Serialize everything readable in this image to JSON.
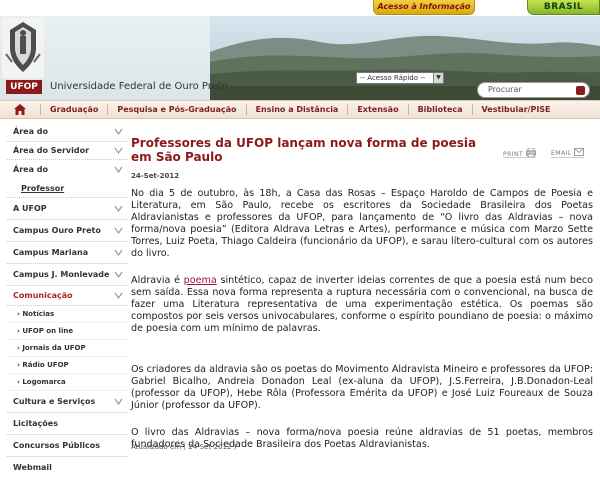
{
  "topbar": {
    "acesso_label": "Acesso à Informação",
    "brasil_label": "BRASIL"
  },
  "header": {
    "badge": "UFOP",
    "university_name": "Universidade Federal de Ouro Preto",
    "quick_access": "-- Acesso Rápido --",
    "search_placeholder": "Procurar"
  },
  "nav": {
    "items": [
      "Graduação",
      "Pesquisa e Pós-Graduação",
      "Ensino a Distância",
      "Extensão",
      "Biblioteca",
      "Vestibular/PISE"
    ]
  },
  "sidebar": {
    "items": [
      {
        "label": "Área do",
        "chevron": true
      },
      {
        "label": "Área do Servidor",
        "chevron": true
      },
      {
        "label": "Área do",
        "chevron": true
      },
      {
        "label": "Professor",
        "chevron": false
      },
      {
        "label": "A UFOP",
        "chevron": true
      },
      {
        "label": "Campus Ouro Preto",
        "chevron": true
      },
      {
        "label": "Campus Mariana",
        "chevron": true
      },
      {
        "label": "Campus J. Monlevade",
        "chevron": true
      },
      {
        "label": "Comunicação",
        "chevron": true
      },
      {
        "label": "Cultura e Serviços",
        "chevron": true
      },
      {
        "label": "Licitações",
        "chevron": false
      },
      {
        "label": "Concursos Públicos",
        "chevron": false
      },
      {
        "label": "Webmail",
        "chevron": false
      }
    ],
    "comunicacao_subitems": [
      "Notícias",
      "UFOP on line",
      "Jornais da UFOP",
      "Rádio UFOP",
      "Logomarca"
    ]
  },
  "article": {
    "title": "Professores da UFOP lançam nova forma de poesia em São Paulo",
    "print_label": "PRINT",
    "email_label": "EMAIL",
    "date": "24-Set-2012",
    "paragraphs": [
      "No dia 5 de outubro, às 18h, a Casa das Rosas – Espaço Haroldo de Campos de Poesia e Literatura, em São Paulo, recebe os escritores da Sociedade Brasileira dos Poetas Aldravianistas e professores da UFOP, para lançamento de “O livro das Aldravias – nova forma/nova poesia” (Editora Aldrava Letras e Artes), performance e música com Marzo Sette Torres, Luiz Poeta, Thiago Caldeira (funcionário da UFOP), e sarau lítero-cultural com os autores do livro.",
      "Os criadores da aldravia são os poetas do Movimento Aldravista Mineiro e professores da UFOP: Gabriel Bicalho, Andreia Donadon Leal (ex-aluna da UFOP), J.S.Ferreira, J.B.Donadon-Leal (professor da UFOP), Hebe Rôla (Professora Emérita da UFOP) e José Luiz Foureaux de Souza Júnior (professor da UFOP).",
      "O livro das Aldravias – nova forma/nova poesia reúne aldravias de 51 poetas, membros fundadores da Sociedade Brasileira dos Poetas Aldravianistas."
    ],
    "para2_prefix": "Aldravia é ",
    "para2_link": "poema",
    "para2_suffix": " sintético, capaz de inverter ideias correntes de que a poesia está num beco sem saída. Essa nova forma representa a ruptura necessária com o convencional, na busca de fazer uma Literatura representativa de uma experimentação estética. Os poemas são compostos por seis versos univocabulares, conforme o espírito poundiano de poesia: o máximo de poesia com um mínimo de palavras.",
    "updated": "Atualizado em ( 24-Set-2012 )"
  }
}
